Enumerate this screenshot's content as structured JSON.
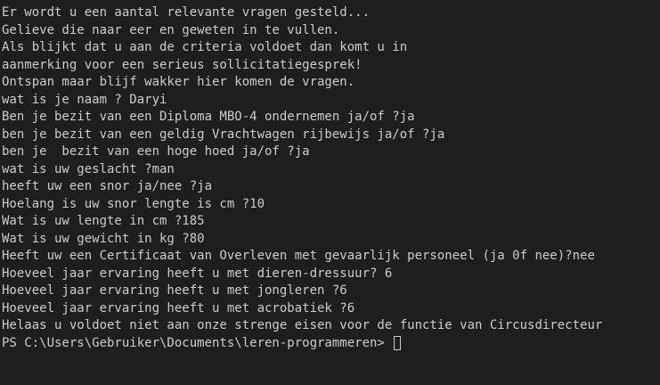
{
  "terminal": {
    "lines": [
      "Er wordt u een aantal relevante vragen gesteld...",
      "Gelieve die naar eer en geweten in te vullen.",
      "Als blijkt dat u aan de criteria voldoet dan komt u in",
      "aanmerking voor een serieus sollicitatiegesprek!",
      "Ontspan maar blijf wakker hier komen de vragen.",
      "wat is je naam ? Daryi",
      "Ben je bezit van een Diploma MBO-4 ondernemen ja/of ?ja",
      "ben je bezit van een geldig Vrachtwagen rijbewijs ja/of ?ja",
      "ben je  bezit van een hoge hoed ja/of ?ja",
      "wat is uw geslacht ?man",
      "heeft uw een snor ja/nee ?ja",
      "Hoelang is uw snor lengte is cm ?10",
      "Wat is uw lengte in cm ?185",
      "Wat is uw gewicht in kg ?80",
      "Heeft uw een Certificaat van Overleven met gevaarlijk personeel (ja 0f nee)?nee",
      "Hoeveel jaar ervaring heeft u met dieren-dressuur? 6",
      "Hoeveel jaar ervaring heeft u met jongleren ?6",
      "Hoeveel jaar ervaring heeft u met acrobatiek ?6",
      "Helaas u voldoet niet aan onze strenge eisen voor de functie van Circusdirecteur"
    ],
    "prompt": "PS C:\\Users\\Gebruiker\\Documents\\leren-programmeren> "
  }
}
